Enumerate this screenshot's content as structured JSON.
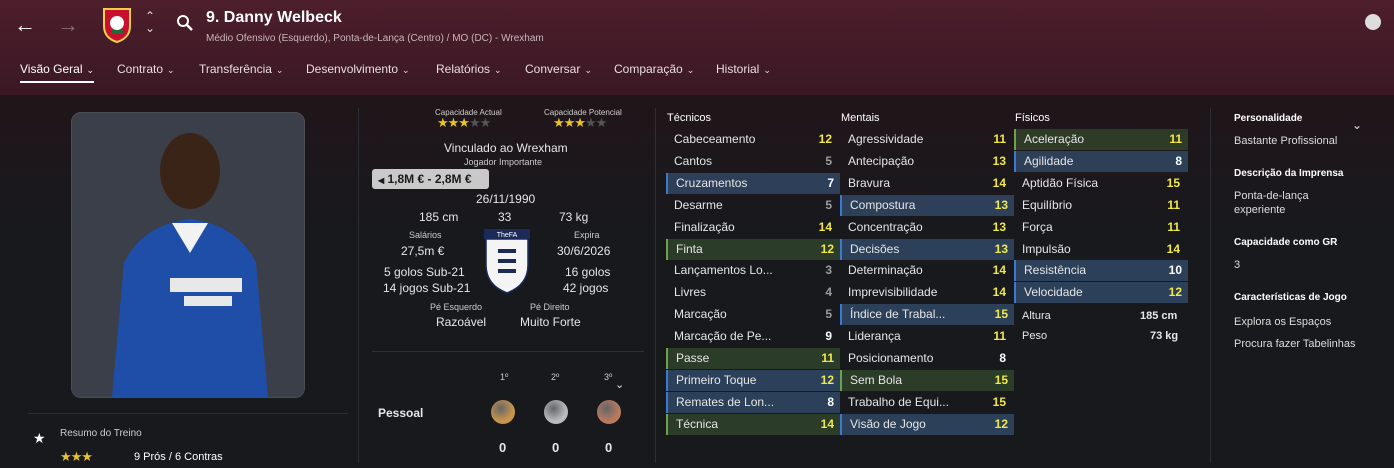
{
  "header": {
    "player_title": "9. Danny Welbeck",
    "subtitle": "Médio Ofensivo (Esquerdo), Ponta-de-Lança (Centro) / MO (DC) - Wrexham",
    "back_icon": "arrow-left-icon",
    "forward_icon": "arrow-right-icon"
  },
  "tabs": [
    {
      "label": "Visão Geral"
    },
    {
      "label": "Contrato"
    },
    {
      "label": "Transferência"
    },
    {
      "label": "Desenvolvimento"
    },
    {
      "label": "Relatórios"
    },
    {
      "label": "Conversar"
    },
    {
      "label": "Comparação"
    },
    {
      "label": "Historial"
    }
  ],
  "overview": {
    "current_ability_label": "Capacidade Actual",
    "potential_ability_label": "Capacidade Potencial",
    "current_ability_stars": 3,
    "potential_ability_stars": 3,
    "contract_club": "Vinculado ao Wrexham",
    "squad_status": "Jogador Importante",
    "value": "1,8M € - 2,8M €",
    "dob": "26/11/1990",
    "height": "185 cm",
    "age": "33",
    "weight": "73 kg",
    "wages_label": "Salários",
    "wages": "27,5m €",
    "expires_label": "Expira",
    "expires": "30/6/2026",
    "intl_left_goals": "5 golos Sub-21",
    "intl_left_caps": "14 jogos Sub-21",
    "intl_right_goals": "16 golos",
    "intl_right_caps": "42 jogos",
    "fa_badge": "TheFA",
    "left_foot_label": "Pé Esquerdo",
    "left_foot": "Razoável",
    "right_foot_label": "Pé Direito",
    "right_foot": "Muito Forte"
  },
  "awards": {
    "label": "Pessoal",
    "positions": [
      "1º",
      "2º",
      "3º"
    ],
    "counts": [
      "0",
      "0",
      "0"
    ],
    "colors": [
      "#c8944a",
      "#b8bcc0",
      "#b97a5e"
    ]
  },
  "training": {
    "label": "Resumo do Treino",
    "stars": 3,
    "summary": "9 Prós / 6 Contras"
  },
  "technical": {
    "title": "Técnicos",
    "rows": [
      {
        "name": "Cabeceamento",
        "value": "12",
        "color": "y",
        "hl": ""
      },
      {
        "name": "Cantos",
        "value": "5",
        "color": "g",
        "hl": ""
      },
      {
        "name": "Cruzamentos",
        "value": "7",
        "color": "w",
        "hl": "hl"
      },
      {
        "name": "Desarme",
        "value": "5",
        "color": "g",
        "hl": ""
      },
      {
        "name": "Finalização",
        "value": "14",
        "color": "y",
        "hl": ""
      },
      {
        "name": "Finta",
        "value": "12",
        "color": "y",
        "hl": "hg"
      },
      {
        "name": "Lançamentos Lo...",
        "value": "3",
        "color": "g",
        "hl": ""
      },
      {
        "name": "Livres",
        "value": "4",
        "color": "g",
        "hl": ""
      },
      {
        "name": "Marcação",
        "value": "5",
        "color": "g",
        "hl": ""
      },
      {
        "name": "Marcação de Pe...",
        "value": "9",
        "color": "w",
        "hl": ""
      },
      {
        "name": "Passe",
        "value": "11",
        "color": "y",
        "hl": "hg"
      },
      {
        "name": "Primeiro Toque",
        "value": "12",
        "color": "y",
        "hl": "hl"
      },
      {
        "name": "Remates de Lon...",
        "value": "8",
        "color": "w",
        "hl": "hl"
      },
      {
        "name": "Técnica",
        "value": "14",
        "color": "y",
        "hl": "hg"
      }
    ]
  },
  "mental": {
    "title": "Mentais",
    "rows": [
      {
        "name": "Agressividade",
        "value": "11",
        "color": "y",
        "hl": ""
      },
      {
        "name": "Antecipação",
        "value": "13",
        "color": "y",
        "hl": ""
      },
      {
        "name": "Bravura",
        "value": "14",
        "color": "y",
        "hl": ""
      },
      {
        "name": "Compostura",
        "value": "13",
        "color": "y",
        "hl": "hl"
      },
      {
        "name": "Concentração",
        "value": "13",
        "color": "y",
        "hl": ""
      },
      {
        "name": "Decisões",
        "value": "13",
        "color": "y",
        "hl": "hl"
      },
      {
        "name": "Determinação",
        "value": "14",
        "color": "y",
        "hl": ""
      },
      {
        "name": "Imprevisibilidade",
        "value": "14",
        "color": "y",
        "hl": ""
      },
      {
        "name": "Índice de Trabal...",
        "value": "15",
        "color": "y",
        "hl": "hl"
      },
      {
        "name": "Liderança",
        "value": "11",
        "color": "y",
        "hl": ""
      },
      {
        "name": "Posicionamento",
        "value": "8",
        "color": "w",
        "hl": ""
      },
      {
        "name": "Sem Bola",
        "value": "15",
        "color": "y",
        "hl": "hg"
      },
      {
        "name": "Trabalho de Equi...",
        "value": "15",
        "color": "y",
        "hl": ""
      },
      {
        "name": "Visão de Jogo",
        "value": "12",
        "color": "y",
        "hl": "hl"
      }
    ]
  },
  "physical": {
    "title": "Físicos",
    "rows": [
      {
        "name": "Aceleração",
        "value": "11",
        "color": "y",
        "hl": "hg"
      },
      {
        "name": "Agilidade",
        "value": "8",
        "color": "w",
        "hl": "hl"
      },
      {
        "name": "Aptidão Física",
        "value": "15",
        "color": "y",
        "hl": ""
      },
      {
        "name": "Equilíbrio",
        "value": "11",
        "color": "y",
        "hl": ""
      },
      {
        "name": "Força",
        "value": "11",
        "color": "y",
        "hl": ""
      },
      {
        "name": "Impulsão",
        "value": "14",
        "color": "y",
        "hl": ""
      },
      {
        "name": "Resistência",
        "value": "10",
        "color": "w",
        "hl": "hl"
      },
      {
        "name": "Velocidade",
        "value": "12",
        "color": "y",
        "hl": "hl"
      }
    ],
    "height_label": "Altura",
    "height_value": "185 cm",
    "weight_label": "Peso",
    "weight_value": "73 kg"
  },
  "side": {
    "personality_label": "Personalidade",
    "personality": "Bastante Profissional",
    "media_label": "Descrição da Imprensa",
    "media_line1": "Ponta-de-lança",
    "media_line2": "experiente",
    "gk_label": "Capacidade como GR",
    "gk_value": "3",
    "traits_label": "Características de Jogo",
    "traits": [
      "Explora os Espaços",
      "Procura fazer Tabelinhas"
    ]
  }
}
